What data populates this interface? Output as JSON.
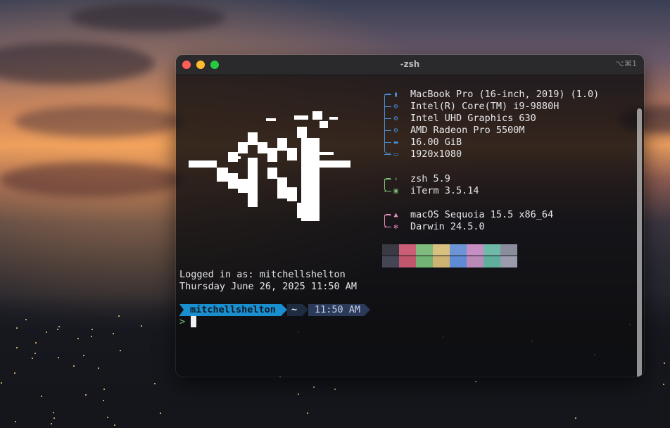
{
  "window": {
    "title": "-zsh",
    "shortcut": "⌥⌘1"
  },
  "sysinfo": [
    {
      "icon": "laptop-icon",
      "glyph": "▮",
      "text": "MacBook Pro (16-inch, 2019) (1.0)",
      "color": "#4a8fd6"
    },
    {
      "icon": "cpu-icon",
      "glyph": "⚙",
      "text": "Intel(R) Core(TM) i9-9880H",
      "color": "#4a8fd6"
    },
    {
      "icon": "gpu-icon",
      "glyph": "⚙",
      "text": "Intel UHD Graphics 630",
      "color": "#4a8fd6"
    },
    {
      "icon": "gpu-icon",
      "glyph": "⚙",
      "text": "AMD Radeon Pro 5500M",
      "color": "#4a8fd6"
    },
    {
      "icon": "memory-icon",
      "glyph": "▬",
      "text": "16.00 GiB",
      "color": "#4a8fd6"
    },
    {
      "icon": "display-icon",
      "glyph": "▭",
      "text": "1920x1080",
      "color": "#4a8fd6"
    },
    {
      "icon": "shell-icon",
      "glyph": "›",
      "text": "zsh 5.9",
      "color": "#7cc47a"
    },
    {
      "icon": "terminal-icon",
      "glyph": "▣",
      "text": "iTerm 3.5.14",
      "color": "#7cc47a"
    },
    {
      "icon": "os-icon",
      "glyph": "▲",
      "text": "macOS Sequoia 15.5 x86_64",
      "color": "#e88fc0"
    },
    {
      "icon": "kernel-icon",
      "glyph": "✻",
      "text": "Darwin 24.5.0",
      "color": "#e88fc0"
    }
  ],
  "palette": {
    "row1": [
      "#3a3a44",
      "#c95e76",
      "#7fba7e",
      "#d8c07e",
      "#6d94d6",
      "#c78ec3",
      "#6fb9a8",
      "#8a8d9d"
    ],
    "row2": [
      "#444656",
      "#c2566d",
      "#72b274",
      "#cdb271",
      "#5f8ad4",
      "#b98ab8",
      "#5fae9b",
      "#9a9cae"
    ]
  },
  "login": {
    "logged_in": "Logged in as: mitchellshelton",
    "datetime": "Thursday June 26, 2025 11:50 AM"
  },
  "prompt": {
    "user": "mitchellshelton",
    "dir": "~",
    "time": "11:50 AM",
    "symbol": ">"
  },
  "colors": {
    "prompt_user_bg": "#1a8fd0",
    "prompt_dir_bg": "#1f2b40",
    "prompt_time_bg": "#2c3a5a",
    "prompt_symbol": "#7cc47a"
  }
}
